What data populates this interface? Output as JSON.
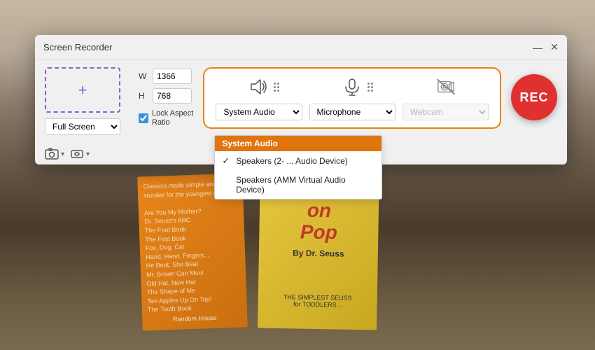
{
  "app": {
    "title": "Screen Recorder",
    "window_controls": {
      "minimize": "—",
      "close": "✕"
    }
  },
  "capture": {
    "plus_label": "+",
    "fullscreen_label": "Full Screen",
    "width_label": "W",
    "height_label": "H",
    "width_value": "1366",
    "height_value": "768",
    "lock_label": "Lock Aspect\nRatio"
  },
  "audio": {
    "system_audio_label": "System Audio",
    "microphone_label": "Microphone",
    "webcam_label": "Webcam",
    "dropdown_header": "System Audio",
    "dropdown_items": [
      {
        "label": "Speakers (2- ... Audio Device)",
        "checked": true
      },
      {
        "label": "Speakers (AMM Virtual Audio Device)",
        "checked": false
      }
    ]
  },
  "rec_button": "REC",
  "icons": {
    "speaker": "🔈",
    "microphone": "🎙",
    "webcam_off": "📷",
    "screenshot": "📷",
    "video": "🎬"
  }
}
